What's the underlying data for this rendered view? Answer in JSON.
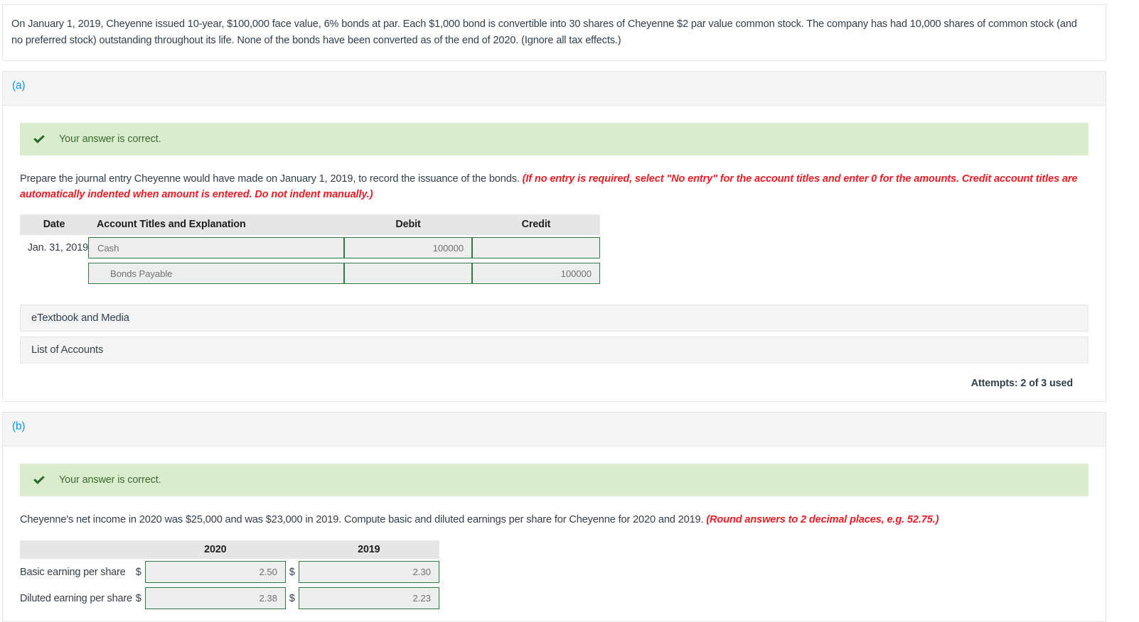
{
  "problem": {
    "statement": "On January 1, 2019, Cheyenne issued 10-year, $100,000 face value, 6% bonds at par. Each $1,000 bond is convertible into 30 shares of Cheyenne $2 par value common stock. The company has had 10,000 shares of common stock (and no preferred stock) outstanding throughout its life. None of the bonds have been converted as of the end of 2020. (Ignore all tax effects.)"
  },
  "colors": {
    "accent_blue": "#0b9ae5",
    "success_bg": "#dbeccc",
    "success_text": "#3d6b35",
    "warning_red": "#ec1c24",
    "input_border_green": "#2f7a3e",
    "input_fill": "#ededed",
    "header_fill": "#e6e6e6",
    "band_fill": "#f4f4f4"
  },
  "section_a": {
    "letter": "(a)",
    "banner": {
      "icon": "check-icon",
      "text": "Your answer is correct."
    },
    "instructions_plain_1": "Prepare the journal entry Cheyenne would have made on January 1, 2019, to record the issuance of the bonds. ",
    "instructions_emphasis": "(If no entry is required, select \"No entry\" for the account titles and enter 0 for the amounts. Credit account titles are automatically indented when amount is entered. Do not indent manually.)",
    "journal": {
      "headers": [
        "Date",
        "Account Titles and Explanation",
        "Debit",
        "Credit"
      ],
      "rows": [
        {
          "date": "Jan. 31, 2019",
          "account": "Cash",
          "indent": false,
          "debit": "100000",
          "credit": ""
        },
        {
          "date": "",
          "account": "Bonds Payable",
          "indent": true,
          "debit": "",
          "credit": "100000"
        }
      ]
    },
    "etextbook_label": "eTextbook and Media",
    "list_of_accounts_label": "List of Accounts",
    "attempts": "Attempts: 2 of 3 used"
  },
  "section_b": {
    "letter": "(b)",
    "banner": {
      "icon": "check-icon",
      "text": "Your answer is correct."
    },
    "instructions_plain_1": "Cheyenne's net income in 2020 was $25,000 and was $23,000 in 2019. Compute basic and diluted earnings per share for Cheyenne for 2020 and 2019. ",
    "instructions_emphasis": "(Round answers to 2 decimal places, e.g. 52.75.)",
    "eps": {
      "blank_header": "",
      "headers": [
        "2020",
        "2019"
      ],
      "currency_symbol": "$",
      "rows": [
        {
          "label": "Basic earning per share",
          "v2020": "2.50",
          "v2019": "2.30"
        },
        {
          "label": "Diluted earning per share",
          "v2020": "2.38",
          "v2019": "2.23"
        }
      ]
    }
  }
}
